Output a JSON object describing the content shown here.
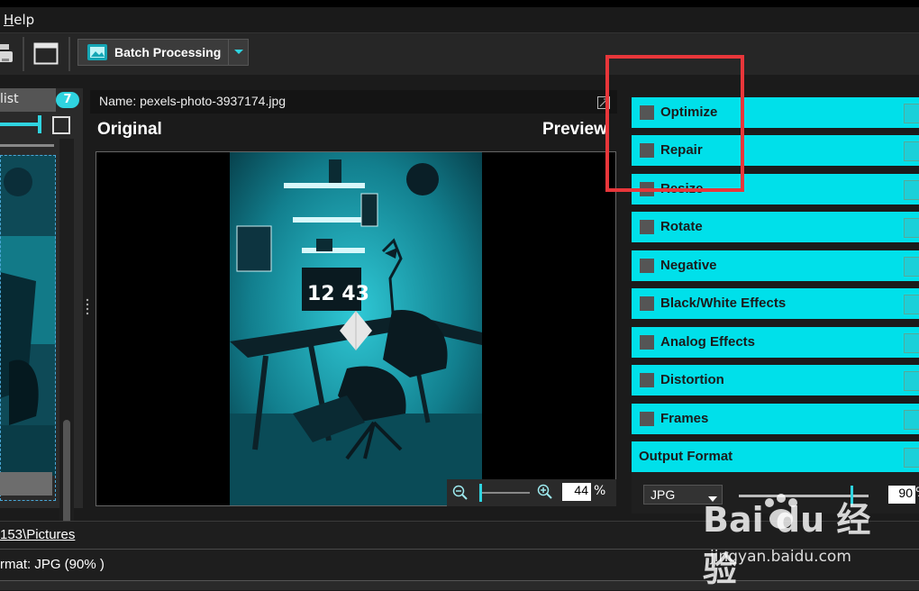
{
  "menubar": {
    "help_accel": "H",
    "help_rest": "elp"
  },
  "toolbar": {
    "batch_label": "Batch Processing"
  },
  "left_panel": {
    "list_tab": "list",
    "count": "7"
  },
  "viewer": {
    "name_label": "Name: pexels-photo-3937174.jpg",
    "original_label": "Original",
    "preview_label": "Preview",
    "clock_text": "12 43",
    "zoom_value": "44",
    "zoom_unit": "%"
  },
  "effects": [
    {
      "label": "Optimize"
    },
    {
      "label": "Repair"
    },
    {
      "label": "Resize"
    },
    {
      "label": "Rotate"
    },
    {
      "label": "Negative"
    },
    {
      "label": "Black/White Effects"
    },
    {
      "label": "Analog Effects"
    },
    {
      "label": "Distortion"
    },
    {
      "label": "Frames"
    }
  ],
  "output": {
    "header": "Output Format",
    "format": "JPG",
    "quality": "90",
    "quality_unit": "%",
    "quality_level": 0.9
  },
  "status": {
    "path": "153\\Pictures",
    "format_info": "rmat: JPG (90% )"
  },
  "watermark": {
    "brand": "Bai du 经验",
    "url": "jingyan.baidu.com"
  },
  "colors": {
    "accent": "#00e0ea",
    "highlight": "#e8363a"
  }
}
